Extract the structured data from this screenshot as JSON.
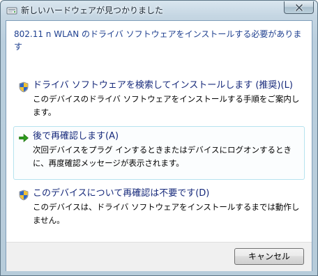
{
  "window": {
    "title": "新しいハードウェアが見つかりました"
  },
  "header": {
    "message": "802.11 n WLAN のドライバ ソフトウェアをインストールする必要があります"
  },
  "options": [
    {
      "icon": "shield-icon",
      "title": "ドライバ ソフトウェアを検索してインストールします (推奨)(L)",
      "description": "このデバイスのドライバ ソフトウェアをインストールする手順をご案内します。"
    },
    {
      "icon": "green-arrow-icon",
      "title": "後で再確認します(A)",
      "description": "次回デバイスをプラグ インするときまたはデバイスにログオンするときに、再度確認メッセージが表示されます。"
    },
    {
      "icon": "shield-icon",
      "title": "このデバイスについて再確認は不要です(D)",
      "description": "このデバイスは、ドライバ ソフトウェアをインストールするまでは動作しません。"
    }
  ],
  "footer": {
    "cancel_label": "キャンセル"
  },
  "colors": {
    "link_blue": "#15287a",
    "header_blue": "#1e3f8f",
    "highlight_border": "#b6e3ef",
    "arrow_green": "#2c9b1c"
  }
}
